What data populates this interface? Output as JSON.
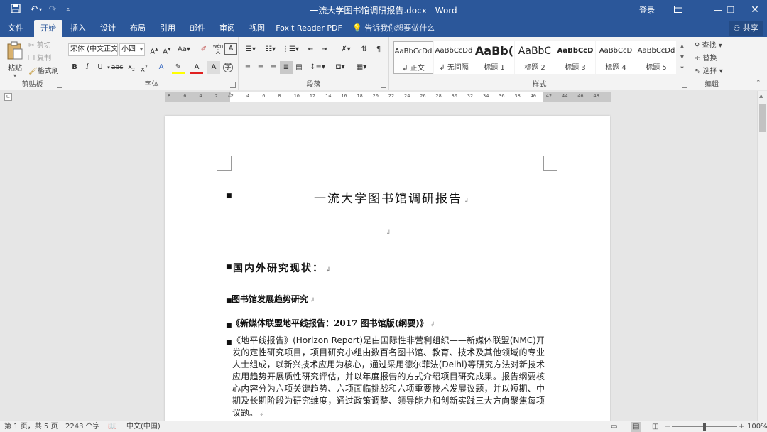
{
  "app": {
    "title": "一流大学图书馆调研报告.docx  -  Word",
    "login_label": "登录"
  },
  "quick_access": {
    "save_icon": "save-icon",
    "undo_icon": "undo-icon",
    "redo_icon": "redo-icon",
    "customize_icon": "customize-qat-icon"
  },
  "tabs": [
    {
      "label": "文件"
    },
    {
      "label": "开始"
    },
    {
      "label": "插入"
    },
    {
      "label": "设计"
    },
    {
      "label": "布局"
    },
    {
      "label": "引用"
    },
    {
      "label": "邮件"
    },
    {
      "label": "审阅"
    },
    {
      "label": "视图"
    },
    {
      "label": "Foxit Reader PDF"
    }
  ],
  "active_tab": "开始",
  "tell_me": "告诉我你想要做什么",
  "share_label": "共享",
  "ribbon": {
    "clipboard": {
      "paste": "粘贴",
      "cut": "剪切",
      "copy": "复制",
      "format_painter": "格式刷",
      "group": "剪贴板"
    },
    "font": {
      "name": "宋体 (中文正文)",
      "size": "小四",
      "group": "字体",
      "case": "Aa"
    },
    "paragraph": {
      "group": "段落"
    },
    "styles": {
      "group": "样式",
      "items": [
        {
          "sample": "AaBbCcDd",
          "name": "↲ 正文"
        },
        {
          "sample": "AaBbCcDd",
          "name": "↲ 无间隔"
        },
        {
          "sample": "AaBb(",
          "name": "标题 1"
        },
        {
          "sample": "AaBbC",
          "name": "标题 2"
        },
        {
          "sample": "AaBbCcD",
          "name": "标题 3"
        },
        {
          "sample": "AaBbCcD",
          "name": "标题 4"
        },
        {
          "sample": "AaBbCcDd",
          "name": "标题 5"
        }
      ]
    },
    "editing": {
      "find": "查找",
      "replace": "替换",
      "select": "选择",
      "group": "编辑"
    }
  },
  "ruler_ticks": [
    "8",
    "6",
    "4",
    "2",
    "2",
    "4",
    "6",
    "8",
    "10",
    "12",
    "14",
    "16",
    "18",
    "20",
    "22",
    "24",
    "26",
    "28",
    "30",
    "32",
    "34",
    "36",
    "38",
    "40",
    "42",
    "44",
    "46",
    "48"
  ],
  "document": {
    "title": "一流大学图书馆调研报告",
    "heading1": "国内外研究现状：",
    "heading2": "图书馆发展趋势研究",
    "heading3": "《新媒体联盟地平线报告：2017 图书馆版(纲要)》",
    "body": "《地平线报告》(Horizon Report)是由国际性非营利组织——新媒体联盟(NMC)开发的定性研究项目，项目研究小组由数百名图书馆、教育、技术及其他领域的专业人士组成，以新兴技术应用为核心，通过采用德尔菲法(Delhi)等研究方法对新技术应用趋势开展质性研究评估，并以年度报告的方式介绍项目研究成果。报告纲要核心内容分为六项关键趋势、六项面临挑战和六项重要技术发展议题，并以短期、中期及长期阶段为研究维度，通过政策调整、领导能力和创新实践三大方向聚焦每项议题。"
  },
  "status": {
    "page": "第 1 页，共 5 页",
    "words": "2243 个字",
    "language": "中文(中国)",
    "zoom": "100%",
    "zoom_minus": "−",
    "zoom_plus": "+"
  }
}
